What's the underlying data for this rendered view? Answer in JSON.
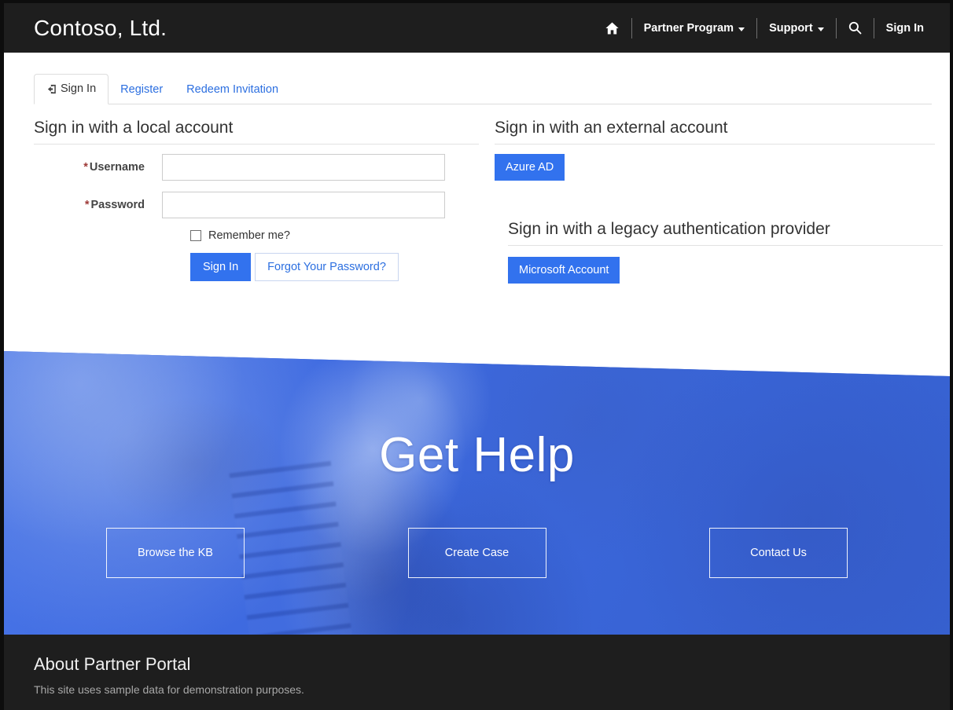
{
  "navbar": {
    "brand": "Contoso, Ltd.",
    "home_icon": "home-icon",
    "search_icon": "search-icon",
    "items": [
      {
        "label": "Partner Program",
        "caret": true
      },
      {
        "label": "Support",
        "caret": true
      }
    ],
    "signin_label": "Sign In"
  },
  "tabs": [
    {
      "label": "Sign In",
      "active": true,
      "icon": "sign-in-icon"
    },
    {
      "label": "Register",
      "active": false
    },
    {
      "label": "Redeem Invitation",
      "active": false
    }
  ],
  "local_account": {
    "heading": "Sign in with a local account",
    "username": {
      "required_mark": "*",
      "label": "Username",
      "value": "",
      "placeholder": ""
    },
    "password": {
      "required_mark": "*",
      "label": "Password",
      "value": "",
      "placeholder": ""
    },
    "remember_label": "Remember me?",
    "remember_checked": false,
    "signin_button": "Sign In",
    "forgot_button": "Forgot Your Password?"
  },
  "external_account": {
    "heading": "Sign in with an external account",
    "buttons": [
      {
        "label": "Azure AD"
      }
    ]
  },
  "legacy_account": {
    "heading": "Sign in with a legacy authentication provider",
    "buttons": [
      {
        "label": "Microsoft Account"
      }
    ]
  },
  "hero": {
    "title": "Get Help",
    "buttons": [
      {
        "label": "Browse the KB"
      },
      {
        "label": "Create Case"
      },
      {
        "label": "Contact Us"
      }
    ]
  },
  "footer": {
    "title": "About Partner Portal",
    "text": "This site uses sample data for demonstration purposes."
  },
  "colors": {
    "header_bg": "#1e1e1e",
    "accent_blue": "#3272ee",
    "link_blue": "#2c6fe0",
    "hero_blue": "#3a66d8",
    "required_red": "#9e3a38"
  }
}
